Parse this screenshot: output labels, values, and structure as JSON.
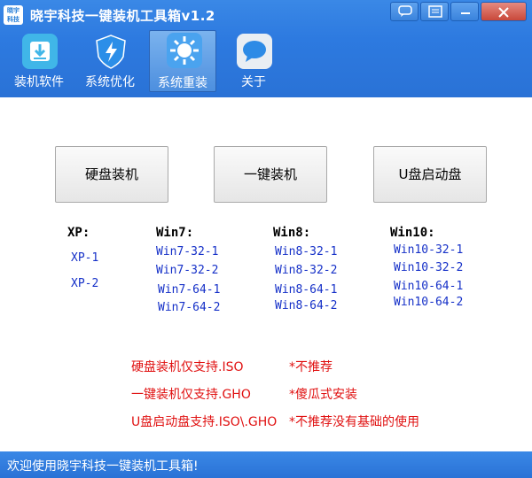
{
  "window": {
    "icon_text": "晓宇\n科技",
    "title": "晓宇科技一键装机工具箱v1.2"
  },
  "toolbar": [
    {
      "label": "装机软件",
      "icon": "download-icon"
    },
    {
      "label": "系统优化",
      "icon": "shield-bolt-icon"
    },
    {
      "label": "系统重装",
      "icon": "gear-sun-icon"
    },
    {
      "label": "关于",
      "icon": "chat-bubble-icon"
    }
  ],
  "buttons": {
    "hdd_install": "硬盘装机",
    "onekey_install": "一键装机",
    "usb_boot": "U盘启动盘"
  },
  "columns": {
    "xp": {
      "head": "XP:",
      "items": [
        "XP-1",
        "XP-2"
      ]
    },
    "win7": {
      "head": "Win7:",
      "items": [
        "Win7-32-1",
        "Win7-32-2",
        "Win7-64-1",
        "Win7-64-2"
      ]
    },
    "win8": {
      "head": "Win8:",
      "items": [
        "Win8-32-1",
        "Win8-32-2",
        "Win8-64-1",
        "Win8-64-2"
      ]
    },
    "win10": {
      "head": "Win10:",
      "items": [
        "Win10-32-1",
        "Win10-32-2",
        "Win10-64-1",
        "Win10-64-2"
      ]
    }
  },
  "notes": [
    {
      "left": "硬盘装机仅支持.ISO",
      "right": "*不推荐"
    },
    {
      "left": "一键装机仅支持.GHO",
      "right": "*傻瓜式安装"
    },
    {
      "left": "U盘启动盘支持.ISO\\.GHO",
      "right": "*不推荐没有基础的使用"
    }
  ],
  "status": "欢迎使用晓宇科技一键装机工具箱!",
  "colors": {
    "titlebar": "#2d7ae0",
    "link": "#1530c8",
    "note": "#e01010"
  }
}
